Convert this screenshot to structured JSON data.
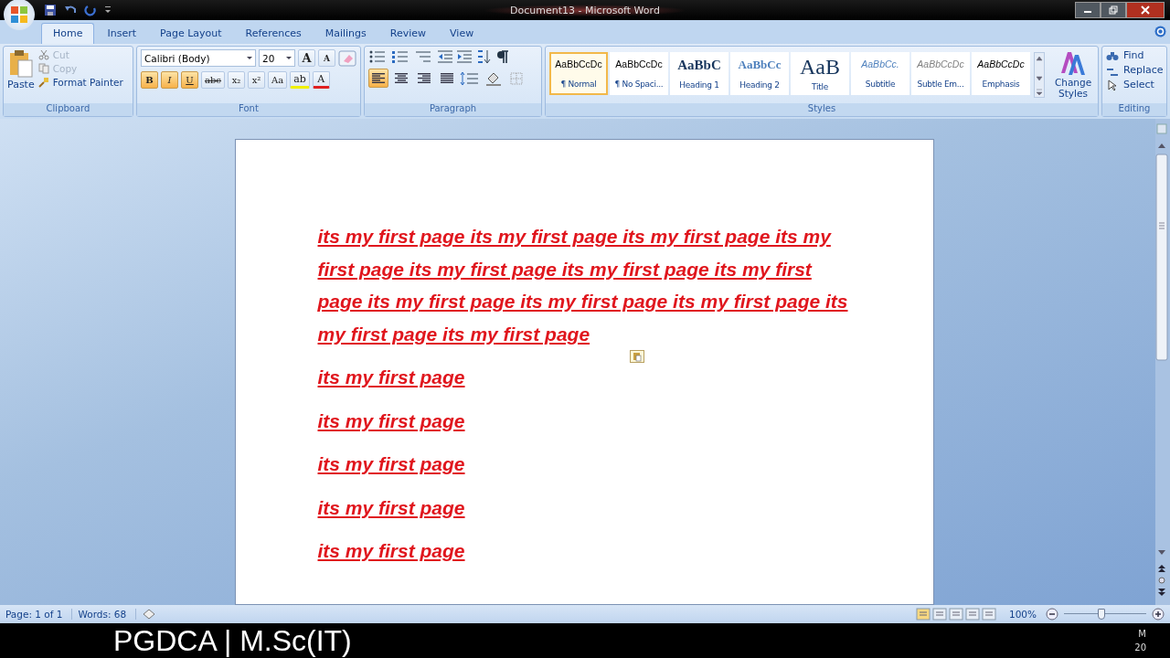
{
  "window": {
    "title": "Document13 - Microsoft Word"
  },
  "tabs": [
    {
      "label": "Home",
      "selected": true
    },
    {
      "label": "Insert",
      "selected": false
    },
    {
      "label": "Page Layout",
      "selected": false
    },
    {
      "label": "References",
      "selected": false
    },
    {
      "label": "Mailings",
      "selected": false
    },
    {
      "label": "Review",
      "selected": false
    },
    {
      "label": "View",
      "selected": false
    }
  ],
  "clipboard": {
    "paste": "Paste",
    "items": [
      {
        "kind": "cut",
        "label": "Cut",
        "disabled": true
      },
      {
        "kind": "copy",
        "label": "Copy",
        "disabled": true
      },
      {
        "kind": "painter",
        "label": "Format Painter",
        "disabled": false
      }
    ],
    "group": "Clipboard"
  },
  "font": {
    "name": "Calibri (Body)",
    "size": "20",
    "grow": "A",
    "shrink": "A",
    "buttons": [
      {
        "label": "B",
        "selected": true
      },
      {
        "label": "I",
        "selected": true
      },
      {
        "label": "U",
        "selected": true
      },
      {
        "label": "abc",
        "selected": false
      },
      {
        "label": "x₂",
        "selected": false
      },
      {
        "label": "x²",
        "selected": false
      },
      {
        "label": "Aa",
        "selected": false
      }
    ],
    "highlight": "ab",
    "font_color_label": "A",
    "group": "Font"
  },
  "paragraph": {
    "align": [
      {
        "selected": true
      },
      {
        "selected": false
      },
      {
        "selected": false
      },
      {
        "selected": false
      }
    ],
    "group": "Paragraph"
  },
  "styles": {
    "items": [
      {
        "preview": "AaBbCcDc",
        "name": "¶ Normal",
        "kind": "normal",
        "selected": true
      },
      {
        "preview": "AaBbCcDc",
        "name": "¶ No Spaci...",
        "kind": "normal",
        "selected": false
      },
      {
        "preview": "AaBbC",
        "name": "Heading 1",
        "kind": "heading1",
        "selected": false
      },
      {
        "preview": "AaBbCc",
        "name": "Heading 2",
        "kind": "heading2",
        "selected": false
      },
      {
        "preview": "AaB",
        "name": "Title",
        "kind": "title",
        "selected": false
      },
      {
        "preview": "AaBbCc.",
        "name": "Subtitle",
        "kind": "subtitle",
        "selected": false
      },
      {
        "preview": "AaBbCcDc",
        "name": "Subtle Em...",
        "kind": "subtle",
        "selected": false
      },
      {
        "preview": "AaBbCcDc",
        "name": "Emphasis",
        "kind": "emphasis",
        "selected": false
      }
    ],
    "change": "Change Styles",
    "group": "Styles"
  },
  "editing": {
    "items": [
      {
        "kind": "find",
        "label": "Find"
      },
      {
        "kind": "replace",
        "label": "Replace"
      },
      {
        "kind": "select",
        "label": "Select"
      }
    ],
    "group": "Editing"
  },
  "document": {
    "paragraphs": [
      "its my first page its my first page its my first page its my first page its my first page its my first page its my first page its my first page its my first page its my first page its my first page its my first page",
      "its my first page",
      "its my first page",
      "its my first page",
      "its my first page",
      "its my first page"
    ]
  },
  "status_bar": {
    "page": "Page: 1 of 1",
    "words": "Words: 68",
    "zoom": "100%",
    "zoom_slider": {
      "level": 0.46
    }
  },
  "caption_bar": {
    "text": "PGDCA | M.Sc(IT)",
    "clock": [
      "M",
      "20"
    ]
  }
}
